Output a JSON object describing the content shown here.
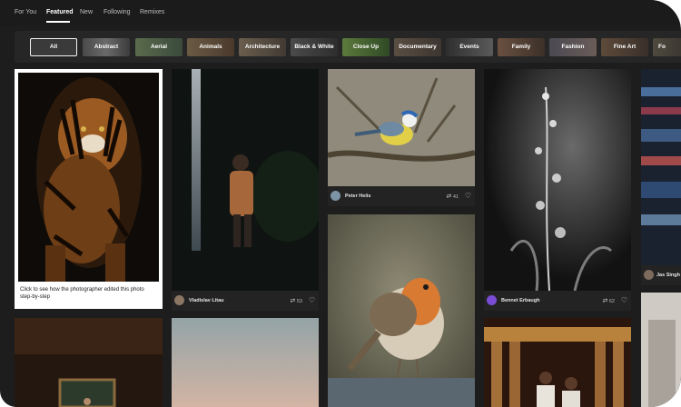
{
  "nav": {
    "tabs": [
      {
        "label": "For You"
      },
      {
        "label": "Featured",
        "active": true
      },
      {
        "label": "New"
      },
      {
        "label": "Following"
      },
      {
        "label": "Remixes"
      }
    ]
  },
  "categories": [
    {
      "label": "All",
      "active": true
    },
    {
      "label": "Abstract"
    },
    {
      "label": "Aerial"
    },
    {
      "label": "Animals"
    },
    {
      "label": "Architecture"
    },
    {
      "label": "Black & White"
    },
    {
      "label": "Close Up"
    },
    {
      "label": "Documentary"
    },
    {
      "label": "Events"
    },
    {
      "label": "Family"
    },
    {
      "label": "Fashion"
    },
    {
      "label": "Fine Art"
    },
    {
      "label": "Fo"
    }
  ],
  "cards": {
    "tiger": {
      "caption": "Click to see how the photographer edited this photo step-by-step"
    },
    "hiker": {
      "author": "Vladislav Litau",
      "remixes": "53"
    },
    "bluetit": {
      "author": "Peter Heiis",
      "remixes": "41"
    },
    "plant": {
      "author": "Bennet Erbaugh",
      "remixes": "62"
    },
    "edge": {
      "author": "Jas Singh"
    }
  },
  "icons": {
    "remix": "remix-icon",
    "heart": "heart-icon"
  },
  "colors": {
    "background": "#1d1d1d",
    "active_tab": "#ffffff",
    "category_bar": "#262626"
  }
}
